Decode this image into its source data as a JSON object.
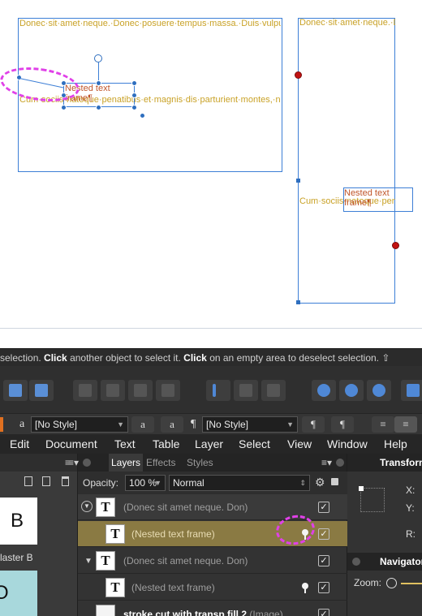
{
  "canvas": {
    "frame_main_text": "Donec·sit·amet·neque.·Donec·posuere·tempus·massa.·Duis·vulputate·mauris·sit·amet·purus.·Duis·vestibulum.·Fusce·ac·erat.·Curabitur·sagittis.·Pellentesque·ultricies,·ante·id·lobortis·feugiat,·ipsum·magna·congue·risus,·pulvinar·euismod·arcu·nunc·ac·turpis.¶",
    "frame_main_text_2": "Cum·sociis·natoque·penatibus·et·magnis·dis·parturient·montes,·nascetur·ridiculus·mus.·Aliquam·vel·quam·ut·tellus·gravida·faucibus.·Vivamus·justo·est,·elementum·vitae,·malesuada·eu,·fermentum·in,·sapien.·Donec·sit·amet·justo.·In·velit.·Vivamus·turpis·pede,·dignissim·sed,·scelerisque·nec,·pretium·sit·amet,·dui.·Nam·nec·felis§",
    "nested_title_left": "Nested text frame¶",
    "frame_right_text": "Donec·sit·amet·neque.·Donec·posuere·tempus·massa.·Duis·vulputate·mauris·sit·amet·purus.·Duis·vestibulum.·Fusce·ac·erat.·Curabitur·sagittis.·Pellentesque·ultricies,·ante·id·lobortis·feugiat,·ipsum·magna·congue·risus,·pulvinar·euismod·arcu·nunc·ac·turpis.¶",
    "frame_right_text_2": "Cum·sociis·natoque·penatibus·et·magnis·dis·parturient·montes,·nascetur·ridiculus·mus.·Aliquam·vel·quam·ut·tellus·gravida·faucibus.·Vivamus·justo·est,·elementum·vitae,·malesuada·eu,·",
    "nested_title_right": "Nested text frame¶"
  },
  "statusbar": {
    "part1": "selection.",
    "bold1": "Click",
    "part2": "another object to select it.",
    "bold2": "Click",
    "part3": "on an empty area to deselect selection.",
    "symbol": "⇧"
  },
  "contextbar": {
    "char_style_glyph": "a",
    "char_style_value": "[No Style]",
    "glyph_a_circle": "a",
    "glyph_a_plain": "a",
    "para_style_glyph": "¶",
    "para_style_value": "[No Style]",
    "glyph_para_circle": "¶",
    "glyph_para_plain": "¶"
  },
  "menubar": {
    "items": [
      "Edit",
      "Document",
      "Text",
      "Table",
      "Layer",
      "Select",
      "View",
      "Window",
      "Help"
    ]
  },
  "leftpanel": {
    "thumb_letter": "B",
    "thumb_label": "laster B"
  },
  "layers": {
    "tabs": [
      "Layers",
      "Effects",
      "Styles"
    ],
    "opacity_label": "Opacity:",
    "opacity_value": "100 %",
    "blend_value": "Normal",
    "rows": [
      {
        "name": "(Donec sit amet neque. Don)",
        "thumb": "T"
      },
      {
        "name": "(Nested text frame)",
        "thumb": "T"
      },
      {
        "name": "(Donec sit amet neque. Don)",
        "thumb": "T"
      },
      {
        "name": "(Nested text frame)",
        "thumb": "T"
      },
      {
        "name": "stroke cut with transp fill 2",
        "suffix": "(Image)"
      }
    ],
    "check": "✓"
  },
  "rightpanel": {
    "transform_tab": "Transform",
    "x_label": "X:",
    "y_label": "Y:",
    "r_label": "R:",
    "navigator_tab": "Navigator",
    "zoom_label": "Zoom:"
  },
  "colors": {
    "accent": "#3d7fd6",
    "text_gold": "#c9a227",
    "nested_orange": "#c0552a",
    "highlight_row": "#8a7a43",
    "annotation": "#e040e8"
  }
}
